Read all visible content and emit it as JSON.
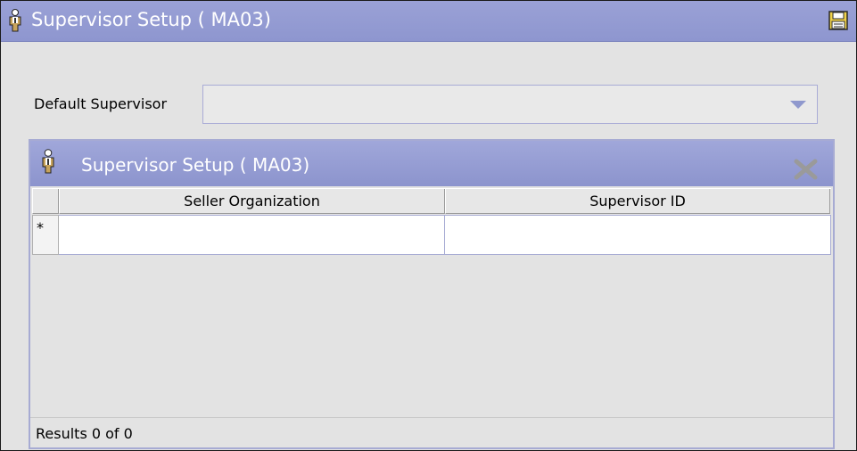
{
  "window": {
    "title": "Supervisor Setup ( MA03)",
    "title_icon": "person-icon",
    "save_icon": "floppy-disk-icon"
  },
  "form": {
    "default_supervisor_label": "Default Supervisor",
    "default_supervisor_value": ""
  },
  "panel": {
    "title": "Supervisor Setup ( MA03)",
    "icon": "person-icon",
    "delete_icon": "delete-x-icon",
    "columns": [
      "Seller Organization",
      "Supervisor ID"
    ],
    "new_row_marker": "*",
    "rows": [
      {
        "seller_organization": "",
        "supervisor_id": ""
      }
    ],
    "results_text": "Results 0 of 0"
  },
  "colors": {
    "title_bar": "#8e96cf",
    "panel_header": "#959ccf",
    "background": "#e3e3e3",
    "accent_border": "#a7abd3"
  }
}
